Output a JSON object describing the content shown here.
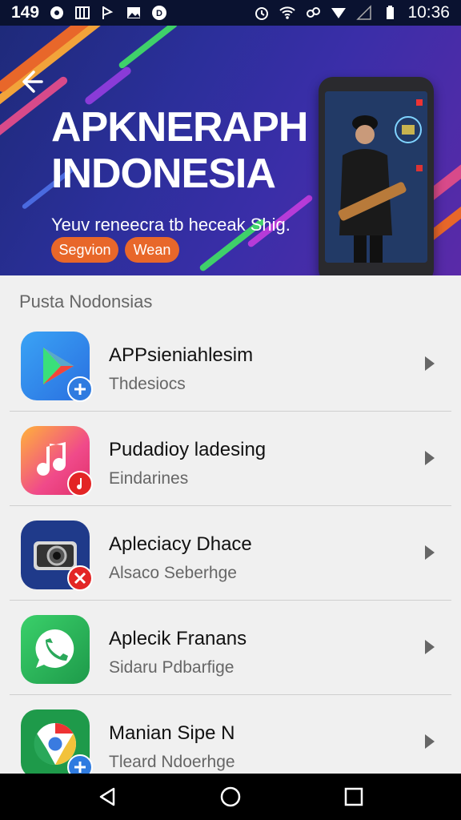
{
  "status_bar": {
    "left_number": "149",
    "time": "10:36",
    "icons": [
      "circle-icon",
      "grid-icon",
      "flag-icon",
      "image-icon",
      "d-icon",
      "alarm-icon",
      "wifi-icon",
      "link-icon",
      "signal-icon",
      "signal-bars-icon",
      "battery-icon"
    ]
  },
  "banner": {
    "title_line1": "APKNERAPH",
    "title_line2": "INDONESIA",
    "subtitle": "Yeuv reneecra tb heceak Shig.",
    "button_primary": "Segvion",
    "button_secondary": "Wean"
  },
  "section_label": "Pusta Nodonsias",
  "apps": [
    {
      "title": "APPsieniahlesim",
      "subtitle": "Thdesiocs",
      "icon": "play-store-icon",
      "badge": "plus-badge-icon"
    },
    {
      "title": "Pudadioy ladesing",
      "subtitle": "Eindarines",
      "icon": "music-note-icon",
      "badge": "music-badge-icon"
    },
    {
      "title": "Apleciacy Dhace",
      "subtitle": "Alsaco Seberhge",
      "icon": "camera-icon",
      "badge": "close-badge-icon"
    },
    {
      "title": "Aplecik Franans",
      "subtitle": "Sidaru Pdbarfige",
      "icon": "phone-chat-icon",
      "badge": ""
    },
    {
      "title": "Manian Sipe N",
      "subtitle": "Tleard Ndoerhge",
      "icon": "chrome-icon",
      "badge": "plus-badge-icon"
    }
  ],
  "colors": {
    "accent_orange": "#e8672a",
    "banner_blue": "#2b2f9a",
    "badge_blue": "#2f7be0",
    "badge_red": "#e32525"
  },
  "nav": {
    "icons": [
      "back-triangle-icon",
      "home-circle-icon",
      "recents-square-icon"
    ]
  }
}
